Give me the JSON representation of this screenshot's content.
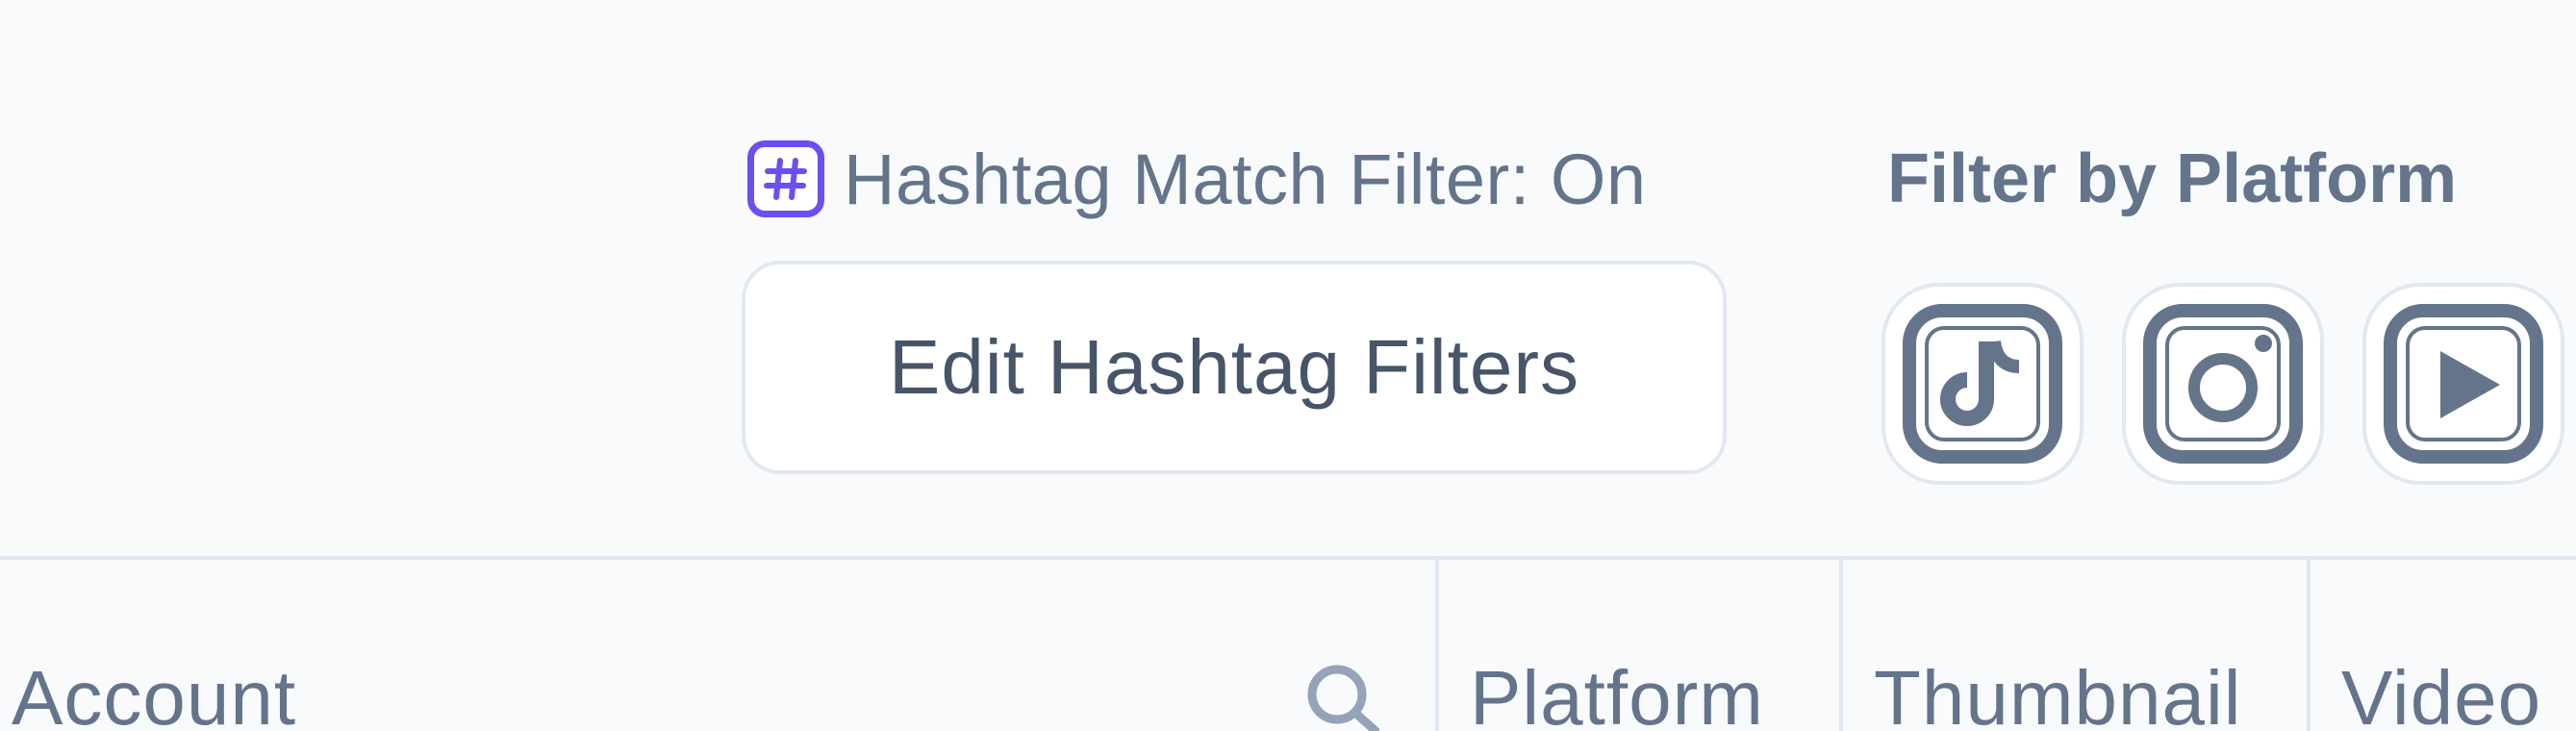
{
  "hashtag_filter": {
    "status_text": "Hashtag Match Filter: On",
    "icon": "hashtag-icon",
    "accent_color": "#6d4ef2"
  },
  "edit_button": {
    "label": "Edit Hashtag Filters"
  },
  "platform_filter": {
    "title": "Filter by Platform",
    "options": [
      {
        "icon": "tiktok-icon"
      },
      {
        "icon": "instagram-icon"
      },
      {
        "icon": "youtube-icon"
      }
    ]
  },
  "table": {
    "columns": [
      {
        "label": "Account",
        "search_icon": "search-icon"
      },
      {
        "label": "Platform"
      },
      {
        "label": "Thumbnail"
      },
      {
        "label": "Video"
      }
    ]
  },
  "colors": {
    "background": "#f8fafc",
    "text": "#64748b",
    "border": "#e2e8f0",
    "icon": "#64748b"
  }
}
